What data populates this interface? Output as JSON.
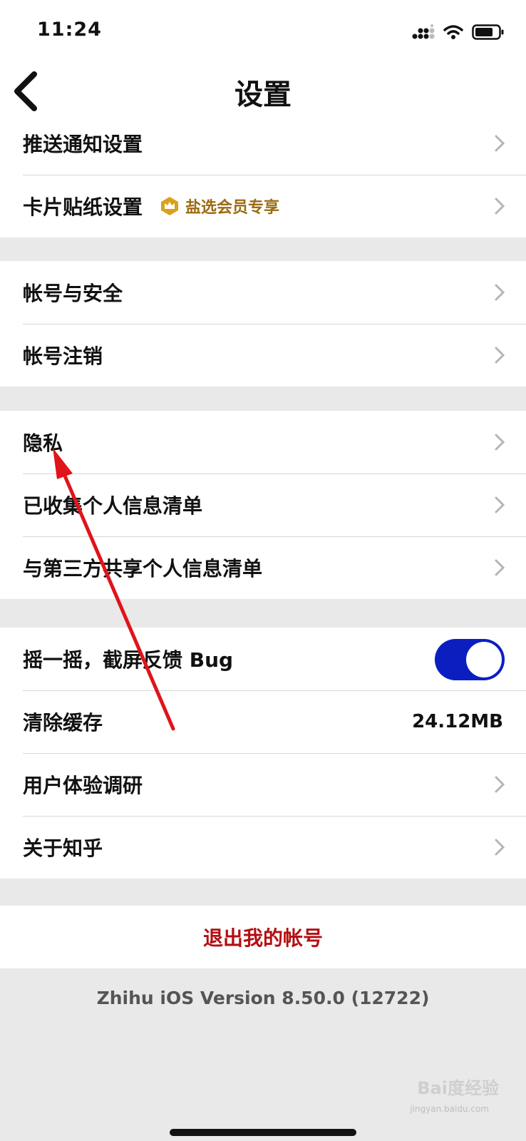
{
  "status": {
    "time": "11:24"
  },
  "nav": {
    "title": "设置"
  },
  "sections": [
    [
      {
        "label": "推送通知设置",
        "chevron": true
      },
      {
        "label": "卡片贴纸设置",
        "badge": "盐选会员专享",
        "chevron": true
      }
    ],
    [
      {
        "label": "帐号与安全",
        "chevron": true
      },
      {
        "label": "帐号注销",
        "chevron": true
      }
    ],
    [
      {
        "label": "隐私",
        "chevron": true
      },
      {
        "label": "已收集个人信息清单",
        "chevron": true
      },
      {
        "label": "与第三方共享个人信息清单",
        "chevron": true
      }
    ],
    [
      {
        "label": "摇一摇，截屏反馈 Bug",
        "toggle": true
      },
      {
        "label": "清除缓存",
        "value": "24.12MB"
      },
      {
        "label": "用户体验调研",
        "chevron": true
      },
      {
        "label": "关于知乎",
        "chevron": true
      }
    ]
  ],
  "logout": {
    "label": "退出我的帐号"
  },
  "version": "Zhihu iOS Version 8.50.0 (12722)",
  "watermark": {
    "brand": "Bai度经验",
    "url": "jingyan.baidu.com"
  },
  "colors": {
    "toggle_on": "#0b1fc0",
    "logout": "#b30f12",
    "badge": "#9a6b12",
    "annotation_arrow": "#e0141a"
  },
  "icons": {
    "back": "chevron-left-icon",
    "row": "chevron-right-icon",
    "badge": "crown-icon"
  }
}
